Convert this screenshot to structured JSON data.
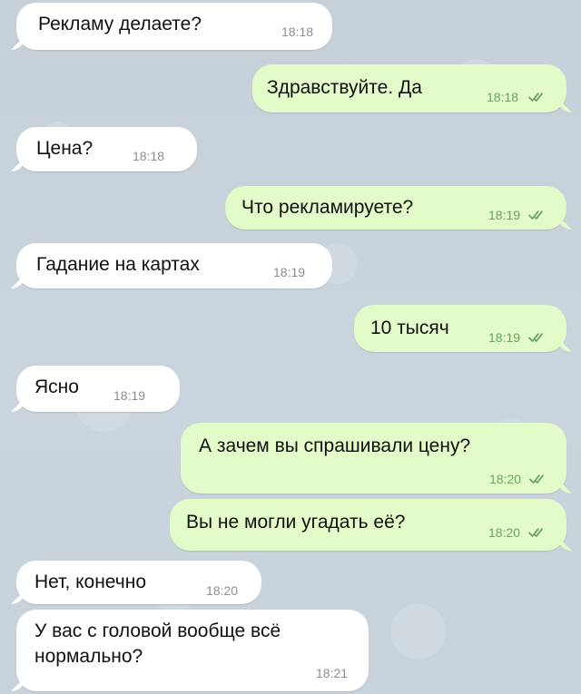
{
  "messages": [
    {
      "direction": "incoming",
      "text": "Рекламу делаете?",
      "time": "18:18"
    },
    {
      "direction": "outgoing",
      "text": "Здравствуйте. Да",
      "time": "18:18",
      "status": "read"
    },
    {
      "direction": "incoming",
      "text": "Цена?",
      "time": "18:18"
    },
    {
      "direction": "outgoing",
      "text": "Что рекламируете?",
      "time": "18:19",
      "status": "read"
    },
    {
      "direction": "incoming",
      "text": "Гадание на картах",
      "time": "18:19"
    },
    {
      "direction": "outgoing",
      "text": "10 тысяч",
      "time": "18:19",
      "status": "read"
    },
    {
      "direction": "incoming",
      "text": "Ясно",
      "time": "18:19"
    },
    {
      "direction": "outgoing",
      "text": "А зачем вы спрашивали цену?",
      "time": "18:20",
      "status": "read"
    },
    {
      "direction": "outgoing",
      "text": "Вы не могли угадать её?",
      "time": "18:20",
      "status": "read"
    },
    {
      "direction": "incoming",
      "text": "Нет, конечно",
      "time": "18:20"
    },
    {
      "direction": "incoming",
      "text_line1": "У вас с головой вообще всё",
      "text_line2": "нормально?",
      "time": "18:21"
    }
  ],
  "colors": {
    "incoming_bubble": "#ffffff",
    "outgoing_bubble": "#e2fbc8",
    "outgoing_time": "#6aa35b",
    "incoming_time": "#8a8f93",
    "background": "#c9d3db"
  },
  "icons": {
    "read_status": "double-check-icon"
  }
}
